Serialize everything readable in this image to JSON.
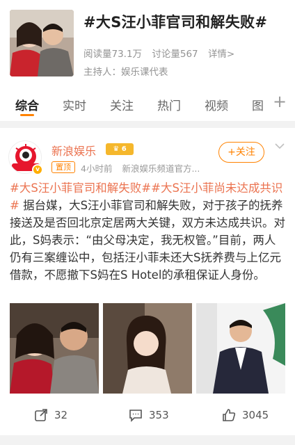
{
  "topic": {
    "title": "#大S汪小菲官司和解失败#",
    "stats": {
      "reads": "阅读量73.1万",
      "discussions": "讨论量567",
      "details": "详情>"
    },
    "host": "主持人：娱乐课代表"
  },
  "tabs": [
    "综合",
    "实时",
    "关注",
    "热门",
    "视频",
    "图"
  ],
  "active_tab": "综合",
  "post": {
    "user_name": "新浪娱乐",
    "level_badge": "6",
    "pin_label": "置顶",
    "time": "4小时前",
    "source": "新浪娱乐频道官方...",
    "follow_label": "+关注",
    "avatar_text": "新浪娱乐",
    "body": {
      "hashtag1": "#大S汪小菲官司和解失败#",
      "hashtag2": "#大S汪小菲尚未达成共识#",
      "text": " 据台媒，大S汪小菲官司和解失败，对于孩子的抚养接送及是否回北京定居两大关键，双方未达成共识。对此，S妈表示：“由父母决定，我无权管。”目前，两人仍有三案缠讼中，包括汪小菲未还大S抚养费与上亿元借款，不愿撤下S妈在S Hotel的承租保证人身份。"
    },
    "reposts": "32",
    "comments": "353",
    "likes": "3045"
  },
  "colors": {
    "accent": "#ff8200",
    "hashtag": "#eb7350",
    "muted": "#939393"
  },
  "icons": [
    "share-icon",
    "comment-icon",
    "like-icon",
    "plus-icon",
    "chevron-down-icon",
    "verified-icon"
  ]
}
